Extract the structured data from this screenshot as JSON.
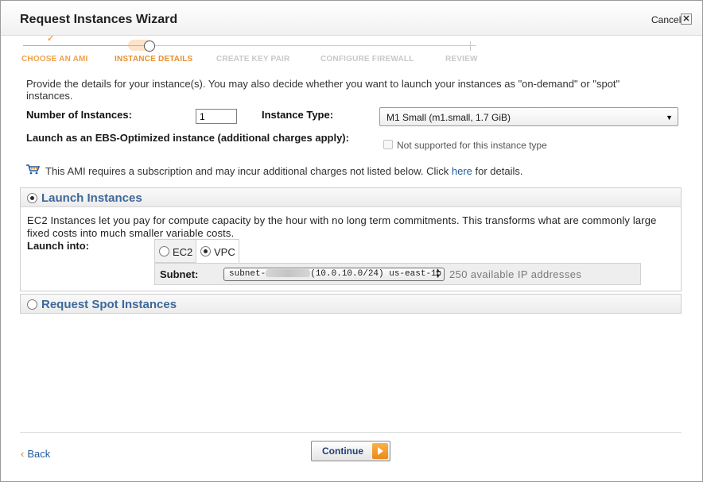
{
  "window": {
    "title": "Request Instances Wizard",
    "cancel_label": "Cancel",
    "close_glyph": "✕"
  },
  "steps": [
    {
      "label": "CHOOSE AN AMI",
      "state": "done"
    },
    {
      "label": "INSTANCE DETAILS",
      "state": "active"
    },
    {
      "label": "CREATE KEY PAIR",
      "state": "future"
    },
    {
      "label": "CONFIGURE FIREWALL",
      "state": "future"
    },
    {
      "label": "REVIEW",
      "state": "future"
    }
  ],
  "step_check": "✓",
  "intro": "Provide the details for your instance(s). You may also decide whether you want to launch your instances as \"on-demand\" or \"spot\" instances.",
  "form": {
    "num_instances_label": "Number of Instances:",
    "num_instances_value": "1",
    "instance_type_label": "Instance Type:",
    "instance_type_value": "M1 Small (m1.small, 1.7 GiB)",
    "ebs_label": "Launch as an EBS-Optimized instance (additional charges apply):",
    "ebs_note": "Not supported for this instance type"
  },
  "ami_note": {
    "text_before": "This AMI requires a subscription and may incur additional charges not listed below. Click ",
    "link": "here",
    "text_after": " for details."
  },
  "launch_panel": {
    "title": "Launch Instances",
    "description": "EC2 Instances let you pay for compute capacity by the hour with no long term commitments. This transforms what are commonly large fixed costs into much smaller variable costs.",
    "launch_into_label": "Launch into:",
    "tab_ec2": "EC2",
    "tab_vpc": "VPC",
    "subnet_label": "Subnet:",
    "subnet_prefix": "subnet-",
    "subnet_suffix": "(10.0.10.0/24) us-east-1b",
    "ip_count": "250 available IP addresses"
  },
  "spot_panel": {
    "title": "Request Spot Instances"
  },
  "footer": {
    "back_label": "Back",
    "back_arrow": "‹",
    "continue_label": "Continue"
  },
  "colors": {
    "accent_orange": "#f0a14a",
    "link_blue": "#1d5c9e",
    "panel_title_blue": "#3d6899"
  }
}
